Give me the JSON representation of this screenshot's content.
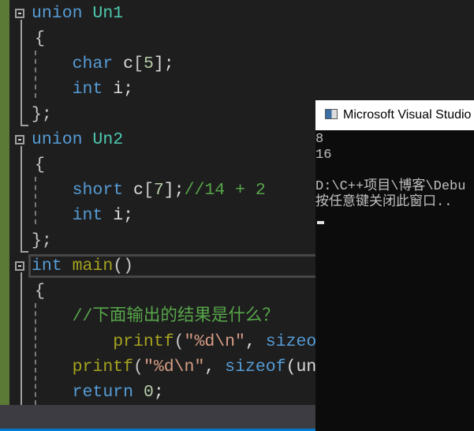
{
  "editor": {
    "lines": [
      [
        [
          "union ",
          "kw"
        ],
        [
          "Un1",
          "ty"
        ]
      ],
      [
        [
          "{",
          "br"
        ]
      ],
      [
        [
          "    ",
          "pl"
        ],
        [
          "char ",
          "kw"
        ],
        [
          "c",
          "pl"
        ],
        [
          "[",
          "br"
        ],
        [
          "5",
          "nu"
        ],
        [
          "];",
          "pl"
        ]
      ],
      [
        [
          "    ",
          "pl"
        ],
        [
          "int ",
          "kw"
        ],
        [
          "i;",
          "pl"
        ]
      ],
      [
        [
          "};",
          "br"
        ]
      ],
      [
        [
          "union ",
          "kw"
        ],
        [
          "Un2",
          "ty"
        ]
      ],
      [
        [
          "{",
          "br"
        ]
      ],
      [
        [
          "    ",
          "pl"
        ],
        [
          "short ",
          "kw"
        ],
        [
          "c",
          "pl"
        ],
        [
          "[",
          "br"
        ],
        [
          "7",
          "nu"
        ],
        [
          "];",
          "pl"
        ],
        [
          "//14 + 2",
          "cm"
        ]
      ],
      [
        [
          "    ",
          "pl"
        ],
        [
          "int ",
          "kw"
        ],
        [
          "i;",
          "pl"
        ]
      ],
      [
        [
          "};",
          "br"
        ]
      ],
      [
        [
          "int ",
          "kw"
        ],
        [
          "main",
          "fn"
        ],
        [
          "()",
          "br"
        ]
      ],
      [
        [
          "{",
          "br"
        ]
      ],
      [
        [
          "    ",
          "pl"
        ],
        [
          "//下面输出的结果是什么？",
          "cm"
        ]
      ],
      [
        [
          "        ",
          "pl"
        ],
        [
          "printf",
          "fn"
        ],
        [
          "(",
          "br"
        ],
        [
          "\"%d\\n\"",
          "st"
        ],
        [
          ", ",
          "pl"
        ],
        [
          "sizeof",
          "kw"
        ]
      ],
      [
        [
          "    ",
          "pl"
        ],
        [
          "printf",
          "fn"
        ],
        [
          "(",
          "br"
        ],
        [
          "\"%d\\n\"",
          "st"
        ],
        [
          ", ",
          "pl"
        ],
        [
          "sizeof",
          "kw"
        ],
        [
          "(un",
          "pl"
        ]
      ],
      [
        [
          "    ",
          "pl"
        ],
        [
          "return ",
          "kw"
        ],
        [
          "0",
          "nu"
        ],
        [
          ";",
          "pl"
        ]
      ]
    ]
  },
  "console": {
    "title": "Microsoft Visual Studio",
    "output": [
      "8",
      "16",
      "",
      "D:\\C++项目\\博客\\Debu",
      "按任意键关闭此窗口.."
    ]
  }
}
